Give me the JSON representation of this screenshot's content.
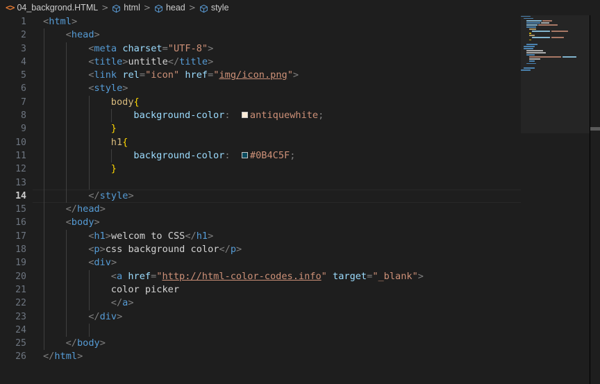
{
  "window": {
    "background": "#1e1e1e",
    "foreground": "#d4d4d4"
  },
  "breadcrumb": {
    "items": [
      {
        "label": "04_backgrond.HTML",
        "icon": "html-file-icon"
      },
      {
        "label": "html",
        "icon": "symbol-structure-cube-icon"
      },
      {
        "label": "head",
        "icon": "symbol-structure-cube-icon"
      },
      {
        "label": "style",
        "icon": "symbol-structure-cube-icon"
      }
    ],
    "separator": ">"
  },
  "editor": {
    "language": "HTML",
    "active_line": 14,
    "total_lines": 26,
    "line_numbers": [
      1,
      2,
      3,
      4,
      5,
      6,
      7,
      8,
      9,
      10,
      11,
      12,
      13,
      14,
      15,
      16,
      17,
      18,
      19,
      20,
      21,
      22,
      23,
      24,
      25,
      26
    ],
    "colors": {
      "tag": "#569cd6",
      "attribute": "#9cdcfe",
      "string": "#ce9178",
      "text": "#d4d4d4",
      "punctuation": "#808080",
      "selector": "#d7ba7d",
      "brace": "#ffd700",
      "property": "#9cdcfe",
      "line_number": "#6e7681",
      "line_number_active": "#cccccc",
      "indent_guide": "#404040"
    },
    "color_swatches": [
      {
        "line": 8,
        "value": "antiquewhite",
        "hex": "#faebd7"
      },
      {
        "line": 11,
        "value": "#0B4C5F",
        "hex": "#0b4c5f"
      }
    ],
    "lines": [
      {
        "n": 1,
        "indent": 0,
        "text": "<html>"
      },
      {
        "n": 2,
        "indent": 1,
        "text": "<head>"
      },
      {
        "n": 3,
        "indent": 2,
        "text": "<meta charset=\"UTF-8\">"
      },
      {
        "n": 4,
        "indent": 2,
        "text": "<title>untitle</title>"
      },
      {
        "n": 5,
        "indent": 2,
        "text": "<link rel=\"icon\" href=\"img/icon.png\">"
      },
      {
        "n": 6,
        "indent": 2,
        "text": "<style>"
      },
      {
        "n": 7,
        "indent": 3,
        "text": "body{"
      },
      {
        "n": 8,
        "indent": 4,
        "text": "background-color:  antiquewhite;"
      },
      {
        "n": 9,
        "indent": 3,
        "text": "}"
      },
      {
        "n": 10,
        "indent": 3,
        "text": "h1{"
      },
      {
        "n": 11,
        "indent": 4,
        "text": "background-color:  #0B4C5F;"
      },
      {
        "n": 12,
        "indent": 3,
        "text": "}"
      },
      {
        "n": 13,
        "indent": 0,
        "text": ""
      },
      {
        "n": 14,
        "indent": 2,
        "text": "</style>"
      },
      {
        "n": 15,
        "indent": 1,
        "text": "</head>"
      },
      {
        "n": 16,
        "indent": 1,
        "text": "<body>"
      },
      {
        "n": 17,
        "indent": 2,
        "text": "<h1>welcom to CSS</h1>"
      },
      {
        "n": 18,
        "indent": 2,
        "text": "<p>css background color</p>"
      },
      {
        "n": 19,
        "indent": 2,
        "text": "<div>"
      },
      {
        "n": 20,
        "indent": 3,
        "text": "<a href=\"http://html-color-codes.info\" target=\"_blank\">"
      },
      {
        "n": 21,
        "indent": 3,
        "text": "color picker"
      },
      {
        "n": 22,
        "indent": 3,
        "text": "</a>"
      },
      {
        "n": 23,
        "indent": 2,
        "text": "</div>"
      },
      {
        "n": 24,
        "indent": 0,
        "text": ""
      },
      {
        "n": 25,
        "indent": 1,
        "text": "</body>"
      },
      {
        "n": 26,
        "indent": 0,
        "text": "</html>"
      }
    ],
    "tokens": {
      "l1": [
        [
          "<",
          "punct"
        ],
        [
          "html",
          "tag"
        ],
        [
          ">",
          "punct"
        ]
      ],
      "l2": [
        [
          "<",
          "punct"
        ],
        [
          "head",
          "tag"
        ],
        [
          ">",
          "punct"
        ]
      ],
      "l3": [
        [
          "<",
          "punct"
        ],
        [
          "meta",
          "tag"
        ],
        [
          " ",
          ""
        ],
        [
          "charset",
          "attr"
        ],
        [
          "=",
          "punct"
        ],
        [
          "\"UTF-8\"",
          "str"
        ],
        [
          ">",
          "punct"
        ]
      ],
      "l4": [
        [
          "<",
          "punct"
        ],
        [
          "title",
          "tag"
        ],
        [
          ">",
          "punct"
        ],
        [
          "untitle",
          "txt"
        ],
        [
          "</",
          "punct"
        ],
        [
          "title",
          "tag"
        ],
        [
          ">",
          "punct"
        ]
      ],
      "l5": [
        [
          "<",
          "punct"
        ],
        [
          "link",
          "tag"
        ],
        [
          " ",
          ""
        ],
        [
          "rel",
          "attr"
        ],
        [
          "=",
          "punct"
        ],
        [
          "\"icon\"",
          "str"
        ],
        [
          " ",
          ""
        ],
        [
          "href",
          "attr"
        ],
        [
          "=",
          "punct"
        ],
        [
          "\"",
          "str"
        ],
        [
          "img/icon.png",
          "link"
        ],
        [
          "\"",
          "str"
        ],
        [
          ">",
          "punct"
        ]
      ],
      "l6": [
        [
          "<",
          "punct"
        ],
        [
          "style",
          "tag"
        ],
        [
          ">",
          "punct"
        ]
      ],
      "l7": [
        [
          "body",
          "sel"
        ],
        [
          "{",
          "brace"
        ]
      ],
      "l8": [
        [
          "background-color",
          "prop"
        ],
        [
          ":",
          "punct"
        ],
        [
          "  ",
          ""
        ],
        [
          "SWATCH1",
          ""
        ],
        [
          "antiquewhite",
          "val"
        ],
        [
          ";",
          "punct"
        ]
      ],
      "l9": [
        [
          "}",
          "brace"
        ]
      ],
      "l10": [
        [
          "h1",
          "sel"
        ],
        [
          "{",
          "brace"
        ]
      ],
      "l11": [
        [
          "background-color",
          "prop"
        ],
        [
          ":",
          "punct"
        ],
        [
          "  ",
          ""
        ],
        [
          "SWATCH2",
          ""
        ],
        [
          "#0B4C5F",
          "val"
        ],
        [
          ";",
          "punct"
        ]
      ],
      "l12": [
        [
          "}",
          "brace"
        ]
      ],
      "l14": [
        [
          "</",
          "punct"
        ],
        [
          "style",
          "tag"
        ],
        [
          ">",
          "punct"
        ]
      ],
      "l15": [
        [
          "</",
          "punct"
        ],
        [
          "head",
          "tag"
        ],
        [
          ">",
          "punct"
        ]
      ],
      "l16": [
        [
          "<",
          "punct"
        ],
        [
          "body",
          "tag"
        ],
        [
          ">",
          "punct"
        ]
      ],
      "l17": [
        [
          "<",
          "punct"
        ],
        [
          "h1",
          "tag"
        ],
        [
          ">",
          "punct"
        ],
        [
          "welcom to CSS",
          "txt"
        ],
        [
          "</",
          "punct"
        ],
        [
          "h1",
          "tag"
        ],
        [
          ">",
          "punct"
        ]
      ],
      "l18": [
        [
          "<",
          "punct"
        ],
        [
          "p",
          "tag"
        ],
        [
          ">",
          "punct"
        ],
        [
          "css background color",
          "txt"
        ],
        [
          "</",
          "punct"
        ],
        [
          "p",
          "tag"
        ],
        [
          ">",
          "punct"
        ]
      ],
      "l19": [
        [
          "<",
          "punct"
        ],
        [
          "div",
          "tag"
        ],
        [
          ">",
          "punct"
        ]
      ],
      "l20": [
        [
          "<",
          "punct"
        ],
        [
          "a",
          "tag"
        ],
        [
          " ",
          ""
        ],
        [
          "href",
          "attr"
        ],
        [
          "=",
          "punct"
        ],
        [
          "\"",
          "str"
        ],
        [
          "http://html-color-codes.info",
          "link"
        ],
        [
          "\"",
          "str"
        ],
        [
          " ",
          ""
        ],
        [
          "target",
          "attr"
        ],
        [
          "=",
          "punct"
        ],
        [
          "\"_blank\"",
          "str"
        ],
        [
          ">",
          "punct"
        ]
      ],
      "l21": [
        [
          "color picker",
          "txt"
        ]
      ],
      "l22": [
        [
          "</",
          "punct"
        ],
        [
          "a",
          "tag"
        ],
        [
          ">",
          "punct"
        ]
      ],
      "l23": [
        [
          "</",
          "punct"
        ],
        [
          "div",
          "tag"
        ],
        [
          ">",
          "punct"
        ]
      ],
      "l25": [
        [
          "</",
          "punct"
        ],
        [
          "body",
          "tag"
        ],
        [
          ">",
          "punct"
        ]
      ],
      "l26": [
        [
          "</",
          "punct"
        ],
        [
          "html",
          "tag"
        ],
        [
          ">",
          "punct"
        ]
      ]
    }
  },
  "minimap": {
    "visible": true,
    "rows": [
      [
        [
          0,
          14,
          "#569cd6"
        ]
      ],
      [
        [
          4,
          14,
          "#569cd6"
        ]
      ],
      [
        [
          8,
          22,
          "#9cdcfe"
        ],
        [
          31,
          14,
          "#ce9178"
        ]
      ],
      [
        [
          8,
          20,
          "#569cd6"
        ],
        [
          29,
          12,
          "#d4d4d4"
        ]
      ],
      [
        [
          8,
          16,
          "#9cdcfe"
        ],
        [
          25,
          28,
          "#ce9178"
        ]
      ],
      [
        [
          8,
          14,
          "#569cd6"
        ]
      ],
      [
        [
          12,
          10,
          "#d7ba7d"
        ]
      ],
      [
        [
          16,
          26,
          "#9cdcfe"
        ],
        [
          44,
          24,
          "#ce9178"
        ]
      ],
      [
        [
          12,
          3,
          "#ffd700"
        ]
      ],
      [
        [
          12,
          8,
          "#d7ba7d"
        ]
      ],
      [
        [
          16,
          26,
          "#9cdcfe"
        ],
        [
          44,
          18,
          "#ce9178"
        ]
      ],
      [
        [
          12,
          3,
          "#ffd700"
        ]
      ],
      [],
      [
        [
          8,
          16,
          "#569cd6"
        ]
      ],
      [
        [
          4,
          16,
          "#569cd6"
        ]
      ],
      [
        [
          4,
          14,
          "#569cd6"
        ]
      ],
      [
        [
          8,
          24,
          "#d4d4d4"
        ]
      ],
      [
        [
          8,
          28,
          "#d4d4d4"
        ]
      ],
      [
        [
          8,
          12,
          "#569cd6"
        ]
      ],
      [
        [
          12,
          46,
          "#ce9178"
        ],
        [
          60,
          20,
          "#9cdcfe"
        ]
      ],
      [
        [
          12,
          16,
          "#d4d4d4"
        ]
      ],
      [
        [
          12,
          8,
          "#569cd6"
        ]
      ],
      [
        [
          8,
          14,
          "#569cd6"
        ]
      ],
      [],
      [
        [
          4,
          16,
          "#569cd6"
        ]
      ],
      [
        [
          0,
          14,
          "#569cd6"
        ]
      ]
    ]
  },
  "scrollbar": {
    "vertical_visible": true,
    "horizontal_mark_visible": true
  }
}
